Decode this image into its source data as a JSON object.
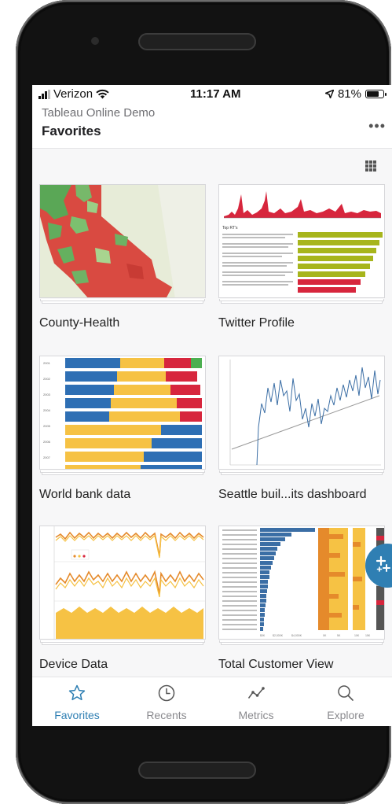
{
  "status_bar": {
    "carrier": "Verizon",
    "time": "11:17 AM",
    "battery": "81%",
    "battery_level": 0.81
  },
  "header": {
    "site_name": "Tableau Online Demo",
    "title": "Favorites",
    "more_label": "•••"
  },
  "favorites": [
    {
      "title": "County-Health"
    },
    {
      "title": "Twitter Profile"
    },
    {
      "title": "World bank data"
    },
    {
      "title": "Seattle buil...its dashboard"
    },
    {
      "title": "Device Data"
    },
    {
      "title": "Total Customer View"
    }
  ],
  "tabs": [
    {
      "label": "Favorites",
      "icon": "star-icon",
      "active": true
    },
    {
      "label": "Recents",
      "icon": "clock-icon",
      "active": false
    },
    {
      "label": "Metrics",
      "icon": "metrics-icon",
      "active": false
    },
    {
      "label": "Explore",
      "icon": "search-icon",
      "active": false
    }
  ],
  "colors": {
    "accent": "#2f7fb3",
    "tab_inactive": "#8a8a8e",
    "tableau_red": "#d7263d",
    "tableau_green": "#4caf50",
    "tableau_blue": "#2e6fb4",
    "tableau_yellow": "#f6c244"
  }
}
